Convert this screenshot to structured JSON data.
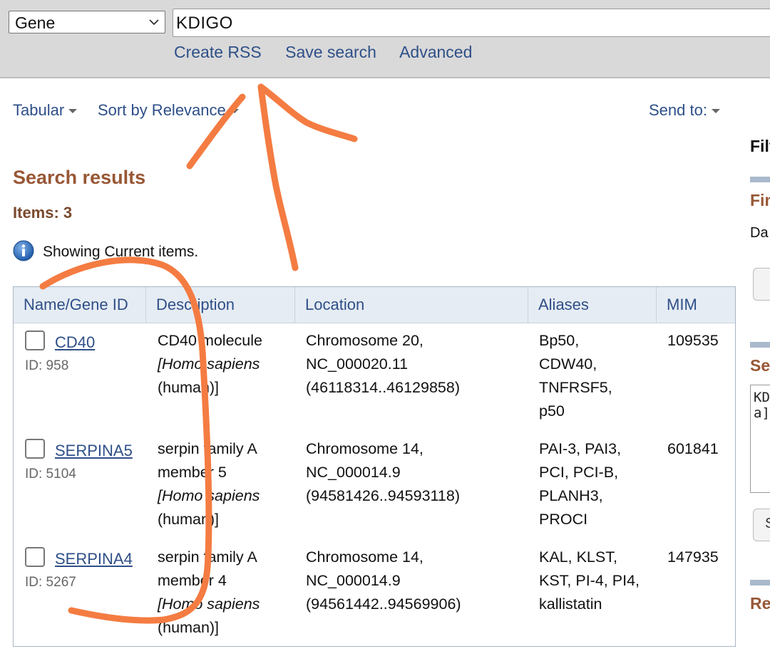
{
  "search": {
    "database": "Gene",
    "query": "KDIGO",
    "links": [
      "Create RSS",
      "Save search",
      "Advanced"
    ]
  },
  "toolbar": {
    "format": "Tabular",
    "sort": "Sort by Relevance",
    "send_to": "Send to:"
  },
  "results": {
    "title": "Search results",
    "count": "Items: 3",
    "info": "Showing Current items."
  },
  "table": {
    "headers": [
      "Name/Gene ID",
      "Description",
      "Location",
      "Aliases",
      "MIM"
    ],
    "rows": [
      {
        "name": "CD40",
        "id": "ID: 958",
        "desc": [
          "CD40 molecule",
          "[Homo sapiens",
          "(human)]"
        ],
        "loc": [
          "Chromosome 20,",
          "NC_000020.11",
          "(46118314..46129858)"
        ],
        "aliases": [
          "Bp50,",
          "CDW40,",
          "TNFRSF5,",
          "p50"
        ],
        "mim": "109535"
      },
      {
        "name": "SERPINA5",
        "id": "ID: 5104",
        "desc": [
          "serpin family A",
          "member 5",
          "[Homo sapiens",
          "(human)]"
        ],
        "loc": [
          "Chromosome 14,",
          "NC_000014.9",
          "(94581426..94593118)"
        ],
        "aliases": [
          "PAI-3, PAI3,",
          "PCI, PCI-B,",
          "PLANH3,",
          "PROCI"
        ],
        "mim": "601841"
      },
      {
        "name": "SERPINA4",
        "id": "ID: 5267",
        "desc": [
          "serpin family A",
          "member 4",
          "[Homo sapiens",
          "(human)]"
        ],
        "loc": [
          "Chromosome 14,",
          "NC_000014.9",
          "(94561442..94569906)"
        ],
        "aliases": [
          "KAL, KLST,",
          "KST, PI-4, PI4,",
          "kallistatin"
        ],
        "mim": "147935"
      }
    ]
  },
  "right_panel": {
    "filters_label": "Filt",
    "find_label": "Fin",
    "date_label": "Da",
    "search_label": "Se",
    "box_lines": [
      "KD",
      "a]"
    ],
    "button_label": "S",
    "recent_label": "Re"
  },
  "colors": {
    "link": "#2e4f88",
    "heading": "#985735",
    "annotation": "#f47c42"
  }
}
